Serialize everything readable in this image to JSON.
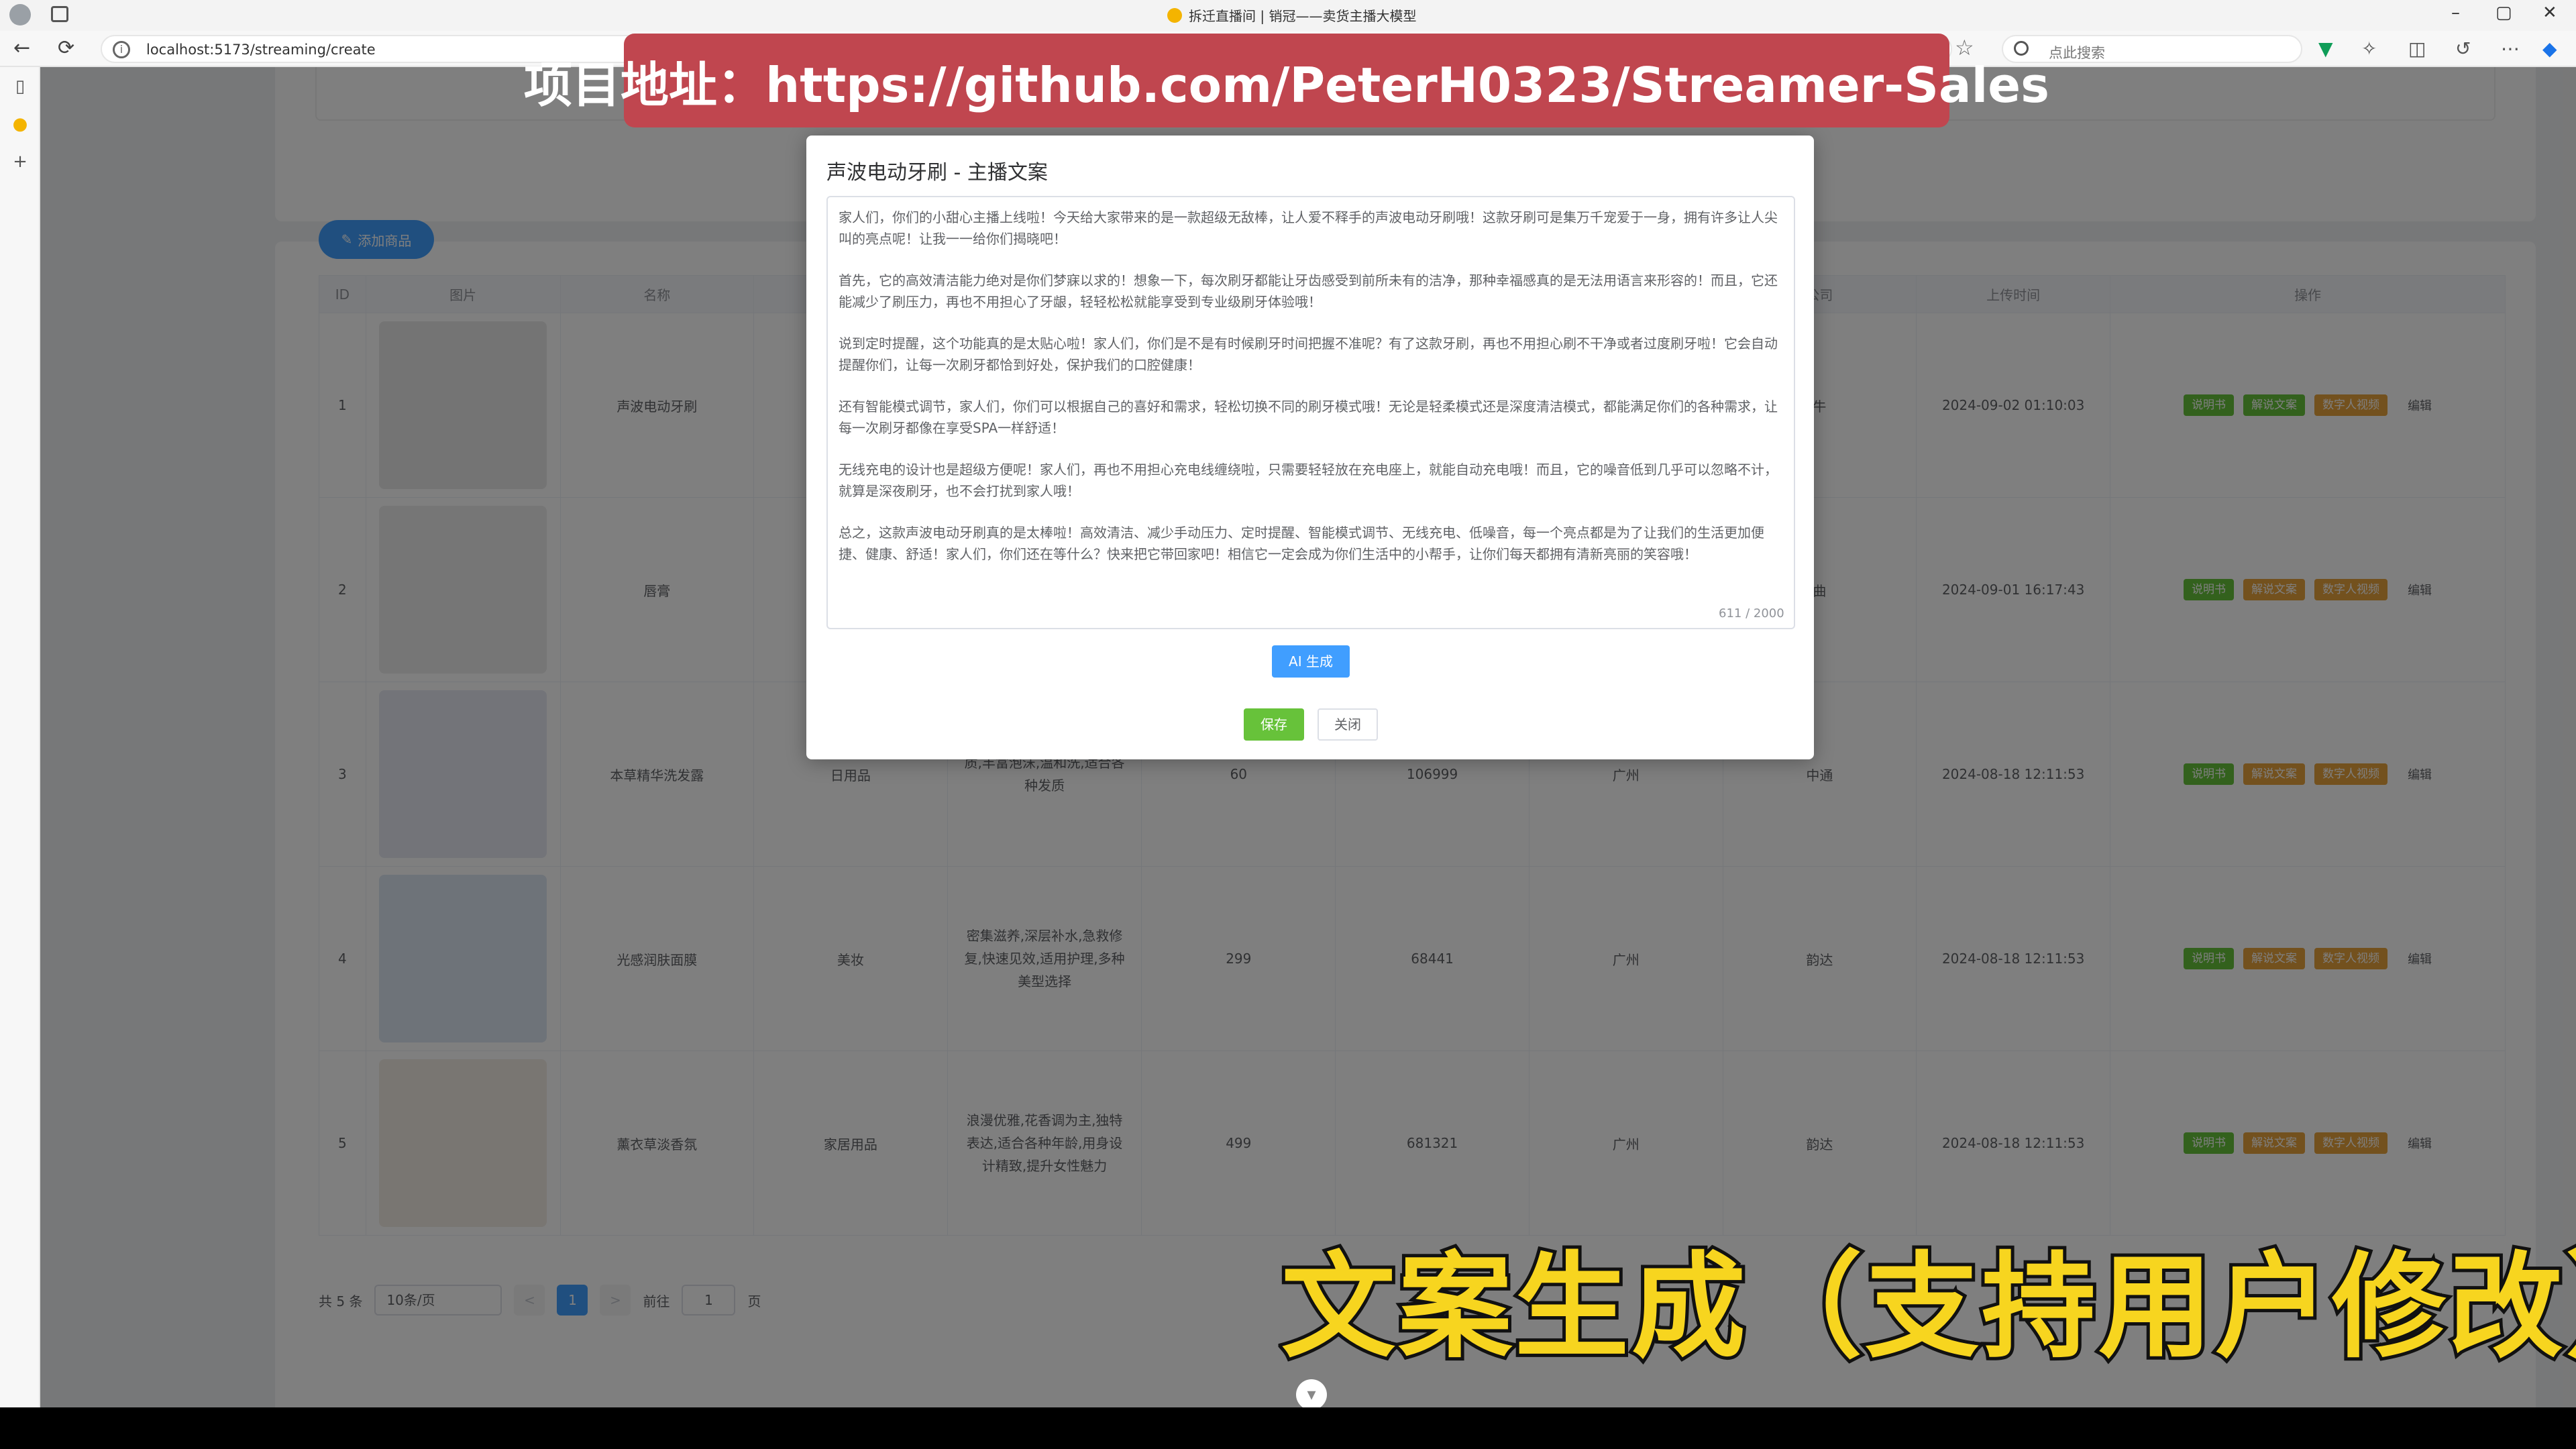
{
  "window": {
    "title": "拆迁直播间 | 销冠——卖货主播大模型",
    "controls": [
      "–",
      "▢",
      "✕"
    ]
  },
  "browser": {
    "url": "localhost:5173/streaming/create",
    "search_placeholder": "点此搜索"
  },
  "banner": {
    "text": "项目地址：https://github.com/PeterH0323/Streamer-Sales"
  },
  "caption": {
    "text": "文案生成（支持用户修改）"
  },
  "toolbar": {
    "add_label": "添加商品"
  },
  "table": {
    "headers": [
      "ID",
      "图片",
      "名称",
      "",
      "",
      "",
      "",
      "",
      "公司",
      "上传时间",
      "操作"
    ],
    "rows": [
      {
        "id": "1",
        "name": "声波电动牙刷",
        "category": "",
        "desc": "",
        "price": "",
        "stock": "",
        "city": "",
        "company": "牛",
        "time": "2024-09-02 01:10:03"
      },
      {
        "id": "2",
        "name": "唇膏",
        "category": "",
        "desc": "",
        "price": "",
        "stock": "",
        "city": "",
        "company": "曲",
        "time": "2024-09-01 16:17:43"
      },
      {
        "id": "3",
        "name": "本草精华洗发露",
        "category": "日用品",
        "desc": "质,丰富泡沫,温和洗,适合各种发质",
        "price": "60",
        "stock": "106999",
        "city": "广州",
        "company": "中通",
        "time": "2024-08-18 12:11:53"
      },
      {
        "id": "4",
        "name": "光感润肤面膜",
        "category": "美妆",
        "desc": "密集滋养,深层补水,急救修复,快速见效,适用护理,多种美型选择",
        "price": "299",
        "stock": "68441",
        "city": "广州",
        "company": "韵达",
        "time": "2024-08-18 12:11:53"
      },
      {
        "id": "5",
        "name": "薰衣草淡香氛",
        "category": "家居用品",
        "desc": "浪漫优雅,花香调为主,独特表达,适合各种年龄,用身设计精致,提升女性魅力",
        "price": "499",
        "stock": "681321",
        "city": "广州",
        "company": "韵达",
        "time": "2024-08-18 12:11:53"
      }
    ],
    "actions": {
      "manual": "说明书",
      "script": "解说文案",
      "digital": "数字人视频",
      "edit": "编辑"
    }
  },
  "pager": {
    "total": "共 5 条",
    "page_size": "10条/页",
    "prev": "<",
    "current": "1",
    "next": ">",
    "goto_label": "前往",
    "goto_value": "1",
    "page_suffix": "页"
  },
  "dialog": {
    "title": "声波电动牙刷 - 主播文案",
    "paragraphs": [
      "家人们，你们的小甜心主播上线啦！今天给大家带来的是一款超级无敌棒，让人爱不释手的声波电动牙刷哦！这款牙刷可是集万千宠爱于一身，拥有许多让人尖叫的亮点呢！让我一一给你们揭晓吧！",
      "首先，它的高效清洁能力绝对是你们梦寐以求的！想象一下，每次刷牙都能让牙齿感受到前所未有的洁净，那种幸福感真的是无法用语言来形容的！而且，它还能减少了刷压力，再也不用担心了牙龈，轻轻松松就能享受到专业级刷牙体验哦！",
      "说到定时提醒，这个功能真的是太贴心啦！家人们，你们是不是有时候刷牙时间把握不准呢？有了这款牙刷，再也不用担心刷不干净或者过度刷牙啦！它会自动提醒你们，让每一次刷牙都恰到好处，保护我们的口腔健康！",
      "还有智能模式调节，家人们，你们可以根据自己的喜好和需求，轻松切换不同的刷牙模式哦！无论是轻柔模式还是深度清洁模式，都能满足你们的各种需求，让每一次刷牙都像在享受SPA一样舒适！",
      "无线充电的设计也是超级方便呢！家人们，再也不用担心充电线缠绕啦，只需要轻轻放在充电座上，就能自动充电哦！而且，它的噪音低到几乎可以忽略不计，就算是深夜刷牙，也不会打扰到家人哦！",
      "总之，这款声波电动牙刷真的是太棒啦！高效清洁、减少手动压力、定时提醒、智能模式调节、无线充电、低噪音，每一个亮点都是为了让我们的生活更加便捷、健康、舒适！家人们，你们还在等什么？快来把它带回家吧！相信它一定会成为你们生活中的小帮手，让你们每天都拥有清新亮丽的笑容哦！"
    ],
    "count": "611 / 2000",
    "ai_label": "AI 生成",
    "save_label": "保存",
    "close_label": "关闭"
  }
}
